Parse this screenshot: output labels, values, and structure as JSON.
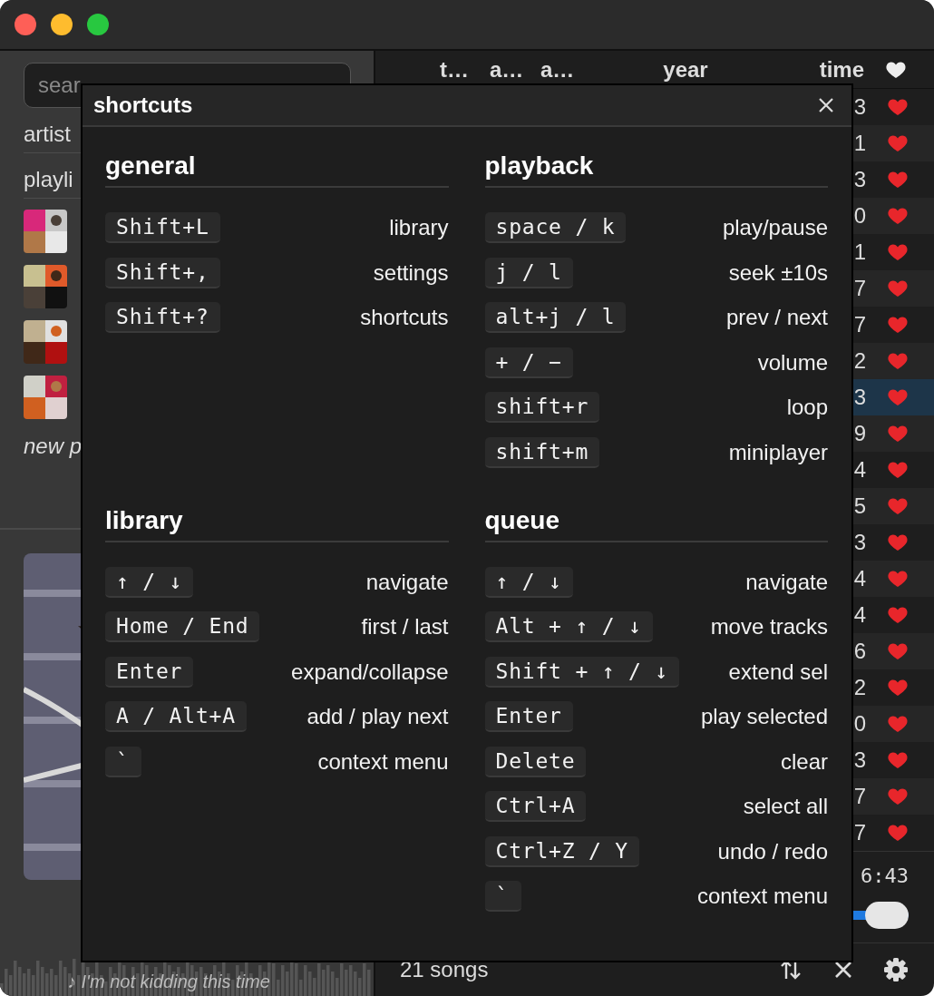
{
  "sidebar": {
    "search": {
      "placeholder": "sear"
    },
    "nav": [
      "artist",
      "playli"
    ],
    "playlists": [
      {
        "kind": "picture"
      },
      {
        "kind": "picture"
      },
      {
        "kind": "picture"
      },
      {
        "kind": "picture"
      }
    ],
    "new_playlist": "new p",
    "now_playing": {
      "artwork": {
        "kind": "picture"
      },
      "lyric": "♪ I'm not kidding this time"
    }
  },
  "table": {
    "columns": [
      "t…",
      "a…",
      "a…",
      "year",
      "time"
    ],
    "rows": [
      {
        "time": "3",
        "liked": true,
        "selected": false
      },
      {
        "time": "1",
        "liked": true,
        "selected": false
      },
      {
        "time": "3",
        "liked": true,
        "selected": false
      },
      {
        "time": "0",
        "liked": true,
        "selected": false
      },
      {
        "time": "1",
        "liked": true,
        "selected": false
      },
      {
        "time": "7",
        "liked": true,
        "selected": false
      },
      {
        "time": "7",
        "liked": true,
        "selected": false
      },
      {
        "time": "2",
        "liked": true,
        "selected": false
      },
      {
        "time": "3",
        "liked": true,
        "selected": true
      },
      {
        "time": "9",
        "liked": true,
        "selected": false
      },
      {
        "time": "4",
        "liked": true,
        "selected": false
      },
      {
        "time": "5",
        "liked": true,
        "selected": false
      },
      {
        "time": "3",
        "liked": true,
        "selected": false
      },
      {
        "time": "4",
        "liked": true,
        "selected": false
      },
      {
        "time": "4",
        "liked": true,
        "selected": false
      },
      {
        "time": "6",
        "liked": true,
        "selected": false
      },
      {
        "time": "2",
        "liked": true,
        "selected": false
      },
      {
        "time": "0",
        "liked": true,
        "selected": false
      },
      {
        "time": "3",
        "liked": true,
        "selected": false
      },
      {
        "time": "7",
        "liked": true,
        "selected": false
      },
      {
        "time": "7",
        "liked": true,
        "selected": false
      }
    ]
  },
  "player": {
    "elapsed": "6:43",
    "seek": {
      "level": 1
    }
  },
  "footer": {
    "count": "21 songs"
  },
  "modal": {
    "title": "shortcuts",
    "sections": [
      {
        "title": "general",
        "shortcuts": [
          {
            "keys": "Shift+L",
            "action": "library"
          },
          {
            "keys": "Shift+,",
            "action": "settings"
          },
          {
            "keys": "Shift+?",
            "action": "shortcuts"
          }
        ]
      },
      {
        "title": "playback",
        "shortcuts": [
          {
            "keys": "space / k",
            "action": "play/pause"
          },
          {
            "keys": "j / l",
            "action": "seek ±10s"
          },
          {
            "keys": "alt+j / l",
            "action": "prev / next"
          },
          {
            "keys": "+ / −",
            "action": "volume"
          },
          {
            "keys": "shift+r",
            "action": "loop"
          },
          {
            "keys": "shift+m",
            "action": "miniplayer"
          }
        ]
      },
      {
        "title": "library",
        "shortcuts": [
          {
            "keys": "↑ / ↓",
            "action": "navigate"
          },
          {
            "keys": "Home / End",
            "action": "first / last"
          },
          {
            "keys": "Enter",
            "action": "expand/collapse"
          },
          {
            "keys": "A / Alt+A",
            "action": "add / play next"
          },
          {
            "keys": "`",
            "action": "context menu"
          }
        ]
      },
      {
        "title": "queue",
        "shortcuts": [
          {
            "keys": "↑ / ↓",
            "action": "navigate"
          },
          {
            "keys": "Alt + ↑ / ↓",
            "action": "move tracks"
          },
          {
            "keys": "Shift + ↑ / ↓",
            "action": "extend sel"
          },
          {
            "keys": "Enter",
            "action": "play selected"
          },
          {
            "keys": "Delete",
            "action": "clear"
          },
          {
            "keys": "Ctrl+A",
            "action": "select all"
          },
          {
            "keys": "Ctrl+Z / Y",
            "action": "undo / redo"
          },
          {
            "keys": "`",
            "action": "context menu"
          }
        ]
      }
    ]
  }
}
